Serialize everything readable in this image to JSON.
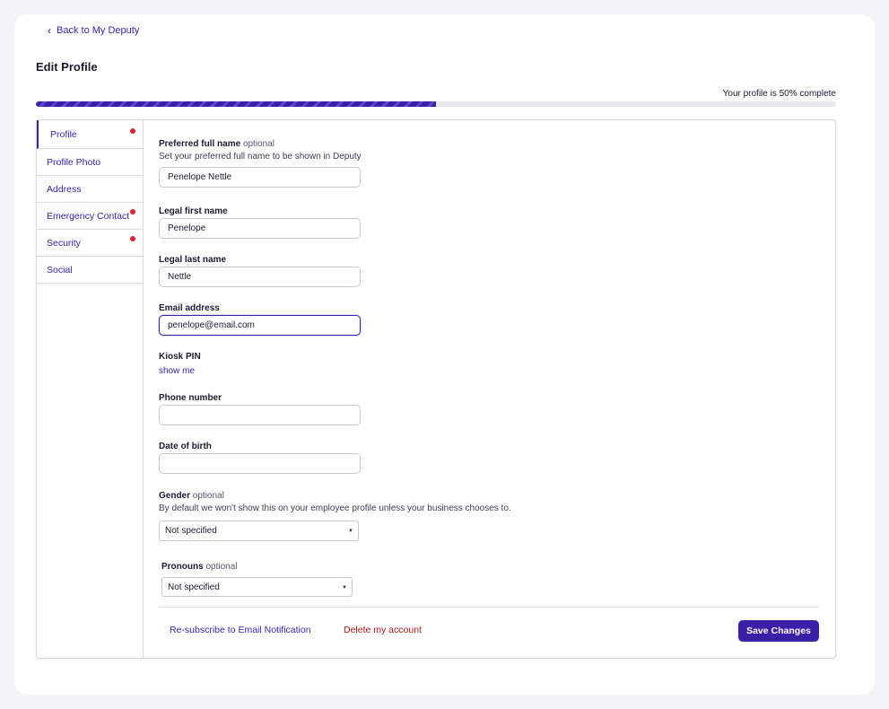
{
  "nav": {
    "back_label": "Back to My Deputy"
  },
  "page": {
    "title": "Edit Profile"
  },
  "progress": {
    "text": "Your profile is 50% complete",
    "percent": 50
  },
  "sidebar": {
    "items": [
      {
        "label": "Profile",
        "active": true,
        "alert": true
      },
      {
        "label": "Profile Photo",
        "active": false,
        "alert": false
      },
      {
        "label": "Address",
        "active": false,
        "alert": false
      },
      {
        "label": "Emergency Contact",
        "active": false,
        "alert": true
      },
      {
        "label": "Security",
        "active": false,
        "alert": true
      },
      {
        "label": "Social",
        "active": false,
        "alert": false
      }
    ]
  },
  "form": {
    "preferred_name": {
      "label": "Preferred full name",
      "optional": "optional",
      "help": "Set your preferred full name to be shown in Deputy",
      "value": "Penelope Nettle"
    },
    "first_name": {
      "label": "Legal first name",
      "value": "Penelope"
    },
    "last_name": {
      "label": "Legal last name",
      "value": "Nettle"
    },
    "email": {
      "label": "Email address",
      "value": "penelope@email.com"
    },
    "kiosk_pin": {
      "label": "Kiosk PIN",
      "link": "show me"
    },
    "phone": {
      "label": "Phone number",
      "value": ""
    },
    "dob": {
      "label": "Date of birth",
      "value": ""
    },
    "gender": {
      "label": "Gender",
      "optional": "optional",
      "help": "By default we won't show this on your employee profile unless your business chooses to.",
      "value": "Not specified"
    },
    "pronouns": {
      "label": "Pronouns",
      "optional": "optional",
      "value": "Not specified"
    }
  },
  "footer": {
    "resubscribe_label": "Re-subscribe to Email Notification",
    "delete_label": "Delete my account",
    "save_label": "Save Changes"
  },
  "colors": {
    "accent": "#3a1fa8",
    "alert": "#e0242f",
    "danger": "#b0151b"
  }
}
